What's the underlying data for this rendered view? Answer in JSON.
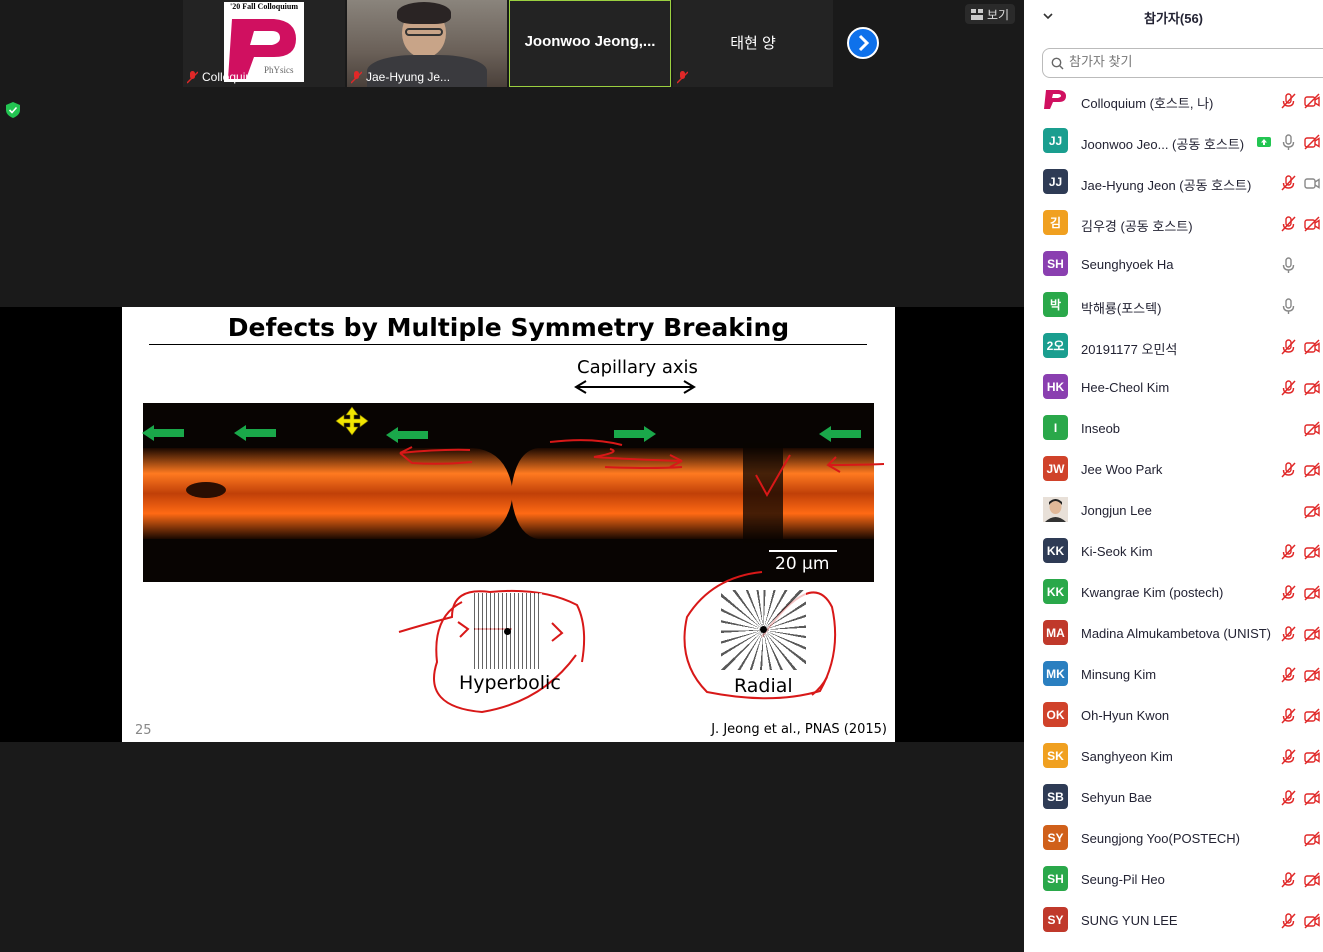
{
  "view_button": "보기",
  "thumbnails": [
    {
      "name": "Colloquium",
      "logo_text": "'20 Fall Colloquium"
    },
    {
      "name": "Jae-Hyung Je..."
    },
    {
      "name": "Joonwoo  Jeong,..."
    },
    {
      "name": "태현 양"
    }
  ],
  "slide": {
    "title": "Defects by Multiple Symmetry Breaking",
    "axis_label": "Capillary axis",
    "scale_label": "20 μm",
    "defect1": "Hyperbolic",
    "defect2": "Radial",
    "page_number": "25",
    "citation": "J. Jeong et al., PNAS (2015)"
  },
  "panel": {
    "title": "참가자(56)",
    "search_placeholder": "참가자 찾기",
    "participants": [
      {
        "initials": "",
        "name": "Colloquium (호스트, 나)",
        "color": "#ffffff",
        "logo": true,
        "mic": "off",
        "cam": "off"
      },
      {
        "initials": "JJ",
        "name": "Joonwoo Jeo...  (공동 호스트)",
        "color": "#1a9e8f",
        "share": true,
        "mic": "on",
        "cam": "off"
      },
      {
        "initials": "JJ",
        "name": "Jae-Hyung Jeon (공동 호스트)",
        "color": "#2e3b55",
        "mic": "off",
        "cam": "on"
      },
      {
        "initials": "김",
        "name": "김우경 (공동 호스트)",
        "color": "#f0a020",
        "mic": "off",
        "cam": "off"
      },
      {
        "initials": "SH",
        "name": "Seunghyoek Ha",
        "color": "#8a3fb0",
        "mic": "on",
        "cam": "none"
      },
      {
        "initials": "박",
        "name": "박해룡(포스텍)",
        "color": "#2aa84a",
        "mic": "on",
        "cam": "none"
      },
      {
        "initials": "2오",
        "name": "20191177 오민석",
        "color": "#1a9e8f",
        "mic": "off",
        "cam": "off"
      },
      {
        "initials": "HK",
        "name": "Hee-Cheol Kim",
        "color": "#8a3fb0",
        "mic": "off",
        "cam": "off"
      },
      {
        "initials": "I",
        "name": "Inseob",
        "color": "#2aa84a",
        "mic": "none",
        "cam": "off"
      },
      {
        "initials": "JW",
        "name": "Jee Woo Park",
        "color": "#d0422a",
        "mic": "off",
        "cam": "off"
      },
      {
        "initials": "",
        "name": "Jongjun Lee",
        "color": "#d8c8b8",
        "photo": true,
        "mic": "none",
        "cam": "off"
      },
      {
        "initials": "KK",
        "name": "Ki-Seok Kim",
        "color": "#2e3b55",
        "mic": "off",
        "cam": "off"
      },
      {
        "initials": "KK",
        "name": "Kwangrae Kim (postech)",
        "color": "#2aa84a",
        "mic": "off",
        "cam": "off"
      },
      {
        "initials": "MA",
        "name": "Madina Almukambetova (UNIST)",
        "color": "#c0392b",
        "mic": "off",
        "cam": "off"
      },
      {
        "initials": "MK",
        "name": "Minsung Kim",
        "color": "#2a7fc0",
        "mic": "off",
        "cam": "off"
      },
      {
        "initials": "OK",
        "name": "Oh-Hyun Kwon",
        "color": "#d0422a",
        "mic": "off",
        "cam": "off"
      },
      {
        "initials": "SK",
        "name": "Sanghyeon Kim",
        "color": "#f0a020",
        "mic": "off",
        "cam": "off"
      },
      {
        "initials": "SB",
        "name": "Sehyun Bae",
        "color": "#2e3b55",
        "mic": "off",
        "cam": "off"
      },
      {
        "initials": "SY",
        "name": "Seungjong Yoo(POSTECH)",
        "color": "#d0601a",
        "mic": "none",
        "cam": "off"
      },
      {
        "initials": "SH",
        "name": "Seung-Pil Heo",
        "color": "#2aa84a",
        "mic": "off",
        "cam": "off"
      },
      {
        "initials": "SY",
        "name": "SUNG YUN LEE",
        "color": "#c0392b",
        "mic": "off",
        "cam": "off"
      }
    ]
  }
}
